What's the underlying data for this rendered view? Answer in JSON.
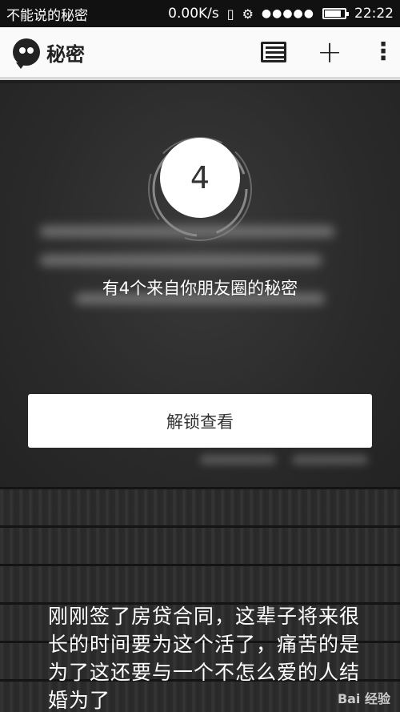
{
  "status_bar": {
    "notification_text": "不能说的秘密",
    "speed": "0.00K/s",
    "signal": "●●●●●",
    "time": "22:22",
    "battery_level": 0.85
  },
  "app_bar": {
    "title": "秘密"
  },
  "card": {
    "count": "4",
    "message": "有4个来自你朋友圈的秘密",
    "unlock_label": "解锁查看"
  },
  "feed": {
    "text": "刚刚签了房贷合同，这辈子将来很长的时间要为这个活了，痛苦的是为了这还要与一个不怎么爱的人结婚为了"
  },
  "watermark": "Bai 经验",
  "colors": {
    "app_bar_bg": "#fafafa",
    "card_bg": "#2a2a2a",
    "button_bg": "#ffffff"
  }
}
